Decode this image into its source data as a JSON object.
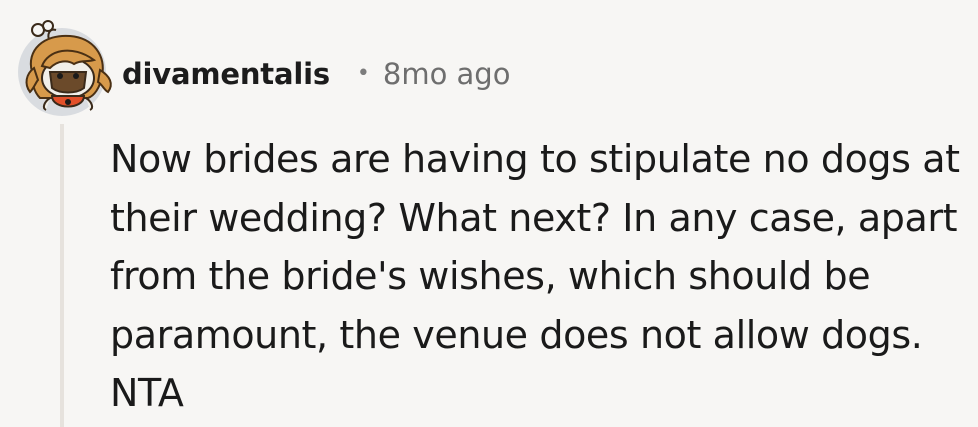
{
  "comment": {
    "username": "divamentalis",
    "separator": "•",
    "age": "8mo ago",
    "body": "Now brides are having to stipulate no dogs at their wedding? What next? In any case, apart from the bride's wishes, which should be paramount, the venue does not allow dogs. NTA",
    "avatar_icon": "snoo-avatar-icon"
  },
  "colors": {
    "background": "#f7f6f4",
    "thread_line": "#e6e2dd",
    "username": "#1c1c1c",
    "meta": "#6e6e6e",
    "text": "#1a1a1a"
  }
}
